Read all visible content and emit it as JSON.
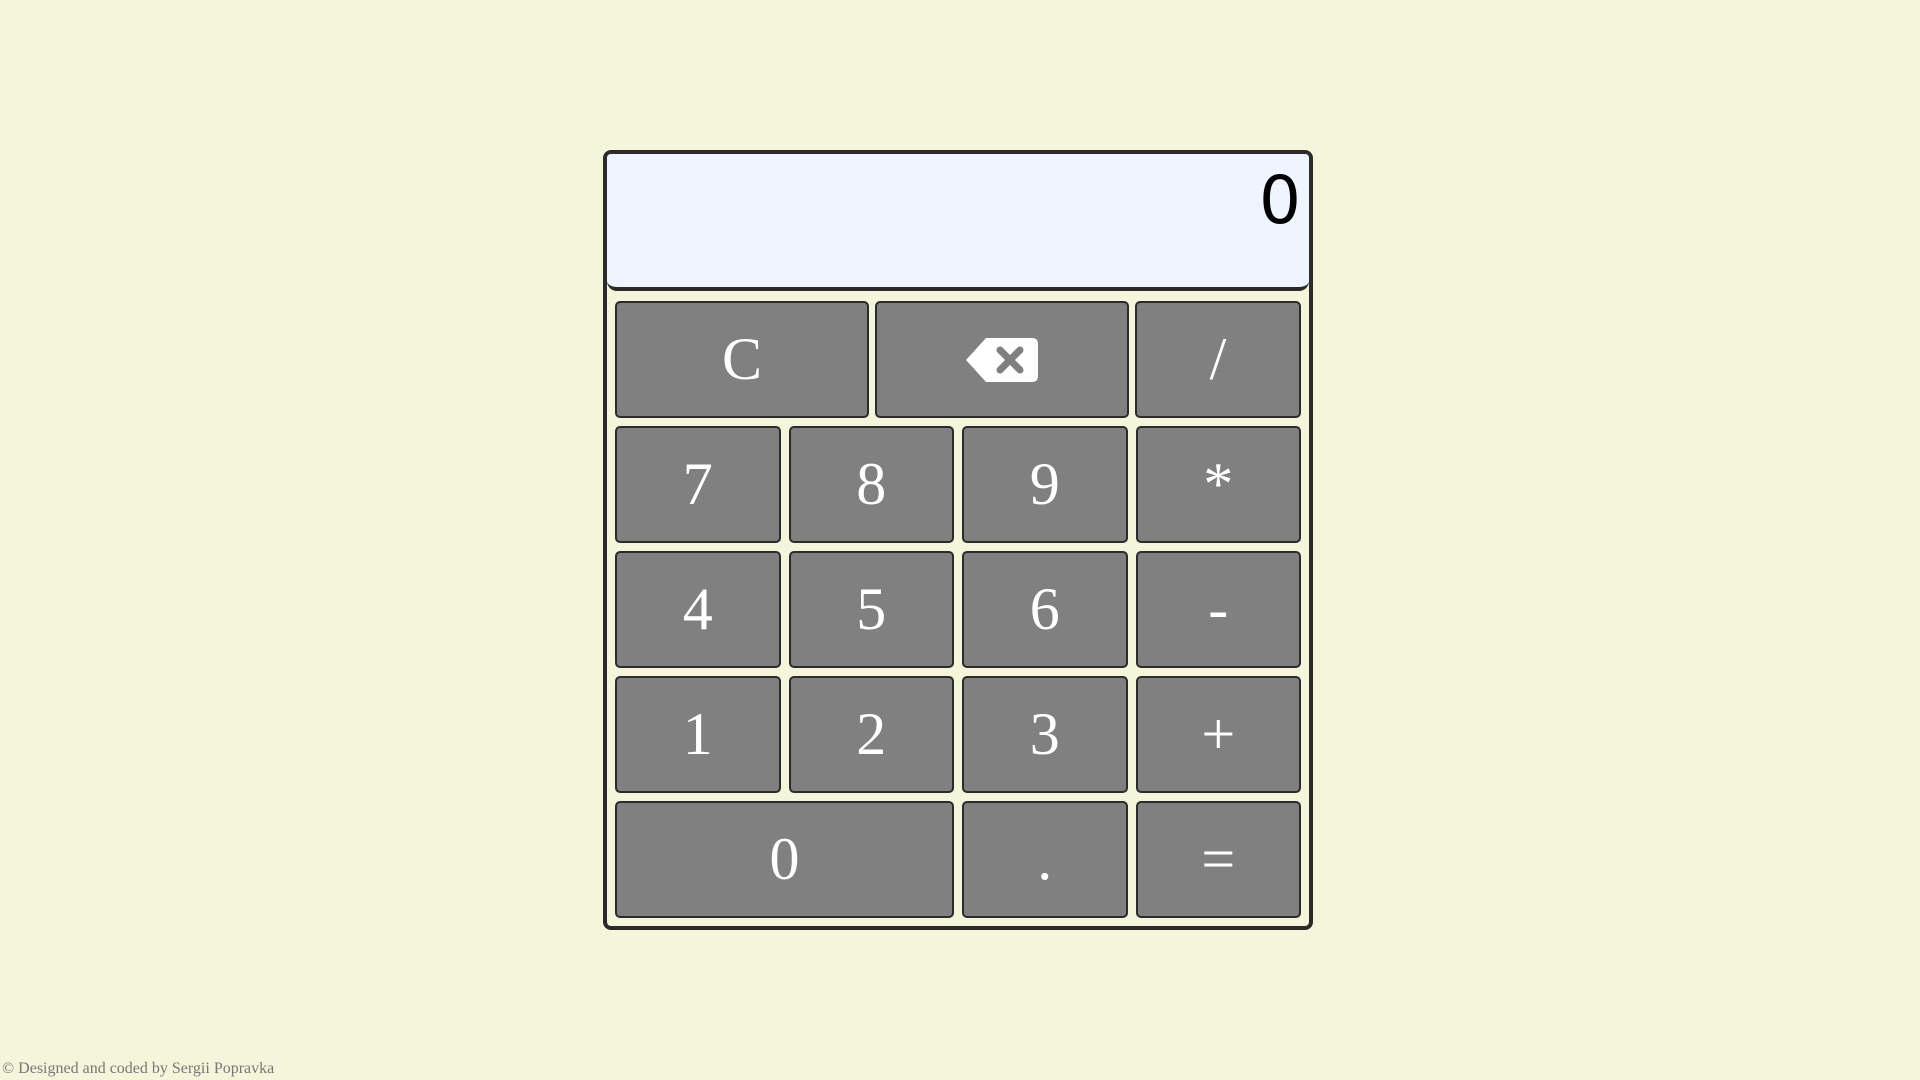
{
  "display": {
    "value": "0"
  },
  "keys": {
    "clear": "C",
    "backspace_icon": "backspace-icon",
    "divide": "/",
    "seven": "7",
    "eight": "8",
    "nine": "9",
    "multiply": "*",
    "four": "4",
    "five": "5",
    "six": "6",
    "subtract": "-",
    "one": "1",
    "two": "2",
    "three": "3",
    "add": "+",
    "zero": "0",
    "decimal": ".",
    "equals": "="
  },
  "footer": {
    "text": "© Designed and coded by Sergii Popravka"
  },
  "colors": {
    "background": "#f5f5dc",
    "display_background": "#eef5ff",
    "key_background": "#808080",
    "key_text": "#ffffff",
    "border": "#2b2b2b"
  }
}
